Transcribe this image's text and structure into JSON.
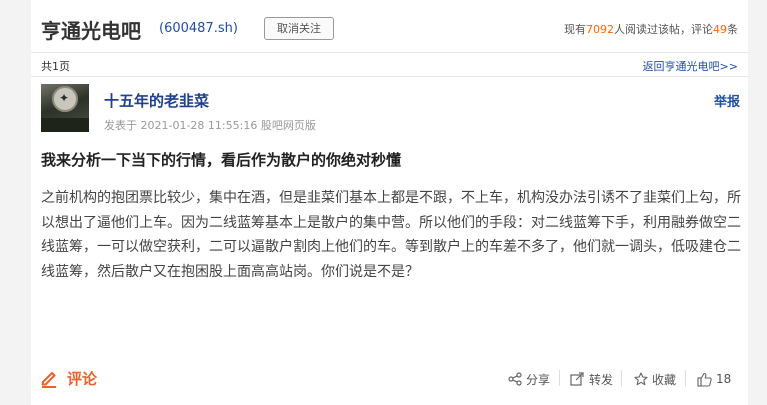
{
  "header": {
    "bar_title": "亨通光电吧",
    "stock_code": "(600487.sh)",
    "follow_button": "取消关注",
    "stats_prefix": "现有",
    "read_count": "7092",
    "stats_middle": "人阅读过该帖，评论",
    "comment_count": "49",
    "stats_suffix": "条"
  },
  "pager": {
    "pages": "共1页",
    "back_link": "返回亨通光电吧>>"
  },
  "post": {
    "author": "十五年的老韭菜",
    "meta": "发表于 2021-01-28 11:55:16 股吧网页版",
    "report": "举报",
    "title": "我来分析一下当下的行情，看后作为散户的你绝对秒懂",
    "body": "之前机构的抱团票比较少，集中在酒，但是韭菜们基本上都是不跟，不上车，机构没办法引诱不了韭菜们上勾，所以想出了逼他们上车。因为二线蓝筹基本上是散户的集中营。所以他们的手段：对二线蓝筹下手，利用融券做空二线蓝筹，一可以做空获利，二可以逼散户割肉上他们的车。等到散户上的车差不多了，他们就一调头，低吸建仓二线蓝筹，然后散户又在抱困股上面高高站岗。你们说是不是？"
  },
  "actions": {
    "comment": "评论",
    "share": "分享",
    "forward": "转发",
    "favorite": "收藏",
    "like_count": "18"
  },
  "icons": {
    "comment": "pencil-icon",
    "share": "share-icon",
    "forward": "forward-icon",
    "favorite": "star-icon",
    "like": "thumbs-up-icon"
  },
  "colors": {
    "link_blue": "#1f4fa8",
    "author_blue": "#1f3f8f",
    "highlight_orange": "#ff6600",
    "comment_orange": "#e8632a"
  }
}
